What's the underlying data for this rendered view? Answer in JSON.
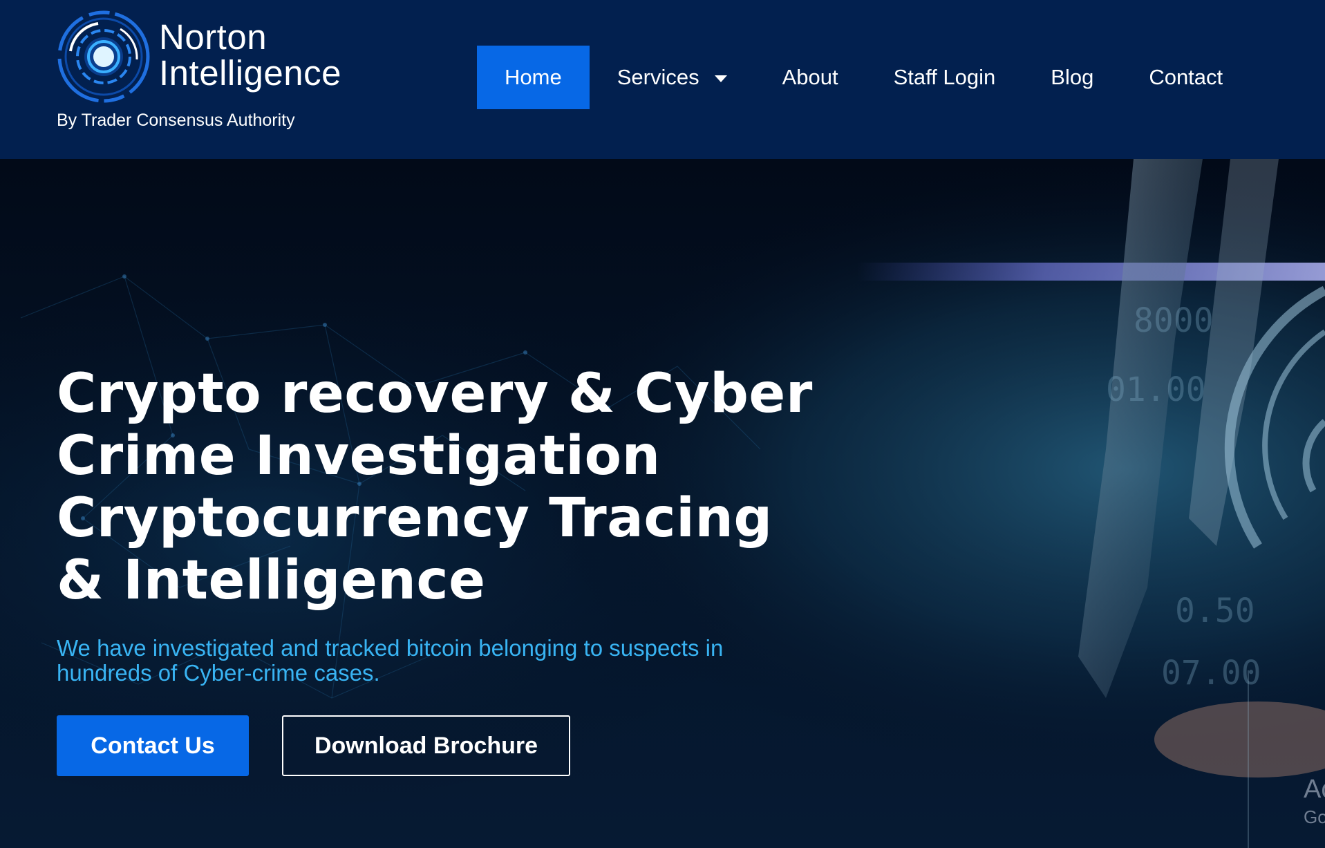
{
  "header": {
    "logo": {
      "name_line1": "Norton",
      "name_line2": "Intelligence",
      "tagline": "By Trader Consensus Authority"
    },
    "nav": [
      {
        "label": "Home",
        "active": true
      },
      {
        "label": "Services",
        "has_dropdown": true
      },
      {
        "label": "About"
      },
      {
        "label": "Staff Login"
      },
      {
        "label": "Blog"
      },
      {
        "label": "Contact"
      }
    ]
  },
  "hero": {
    "title_lines": [
      "Crypto recovery & Cyber",
      "Crime Investigation",
      "Cryptocurrency Tracing",
      "& Intelligence"
    ],
    "subtitle_lines": [
      "We have investigated and tracked bitcoin belonging to suspects in",
      "hundreds of Cyber-crime cases."
    ],
    "primary_button": "Contact Us",
    "secondary_button": "Download Brochure",
    "watermark_line1": "Ac",
    "watermark_line2": "Go"
  },
  "colors": {
    "header_bg": "#02204f",
    "accent_blue": "#0768e6",
    "subtitle_cyan": "#39b4f3",
    "hero_bg": "#030d1f"
  },
  "icons": {
    "logo": "circular-target-emblem-icon",
    "dropdown": "caret-down-icon"
  }
}
